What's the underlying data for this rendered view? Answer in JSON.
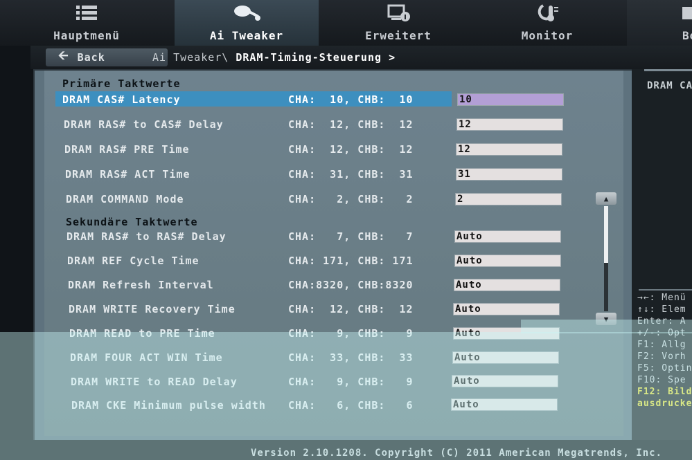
{
  "tabs": [
    {
      "id": "hauptmenu",
      "label": "Hauptmenü",
      "icon": "list-icon"
    },
    {
      "id": "ai-tweaker",
      "label": "Ai Tweaker",
      "icon": "tweaker-icon",
      "active": true
    },
    {
      "id": "erweitert",
      "label": "Erweitert",
      "icon": "advanced-icon"
    },
    {
      "id": "monitor",
      "label": "Monitor",
      "icon": "thermometer-icon"
    },
    {
      "id": "boot",
      "label": "Bo",
      "icon": "boot-icon"
    }
  ],
  "breadcrumb": {
    "back_label": "Back",
    "path": "Ai Tweaker\\",
    "current": "DRAM-Timing-Steuerung",
    "arrow": ">"
  },
  "sections": {
    "primary": "Primäre Taktwerte",
    "secondary": "Sekundäre Taktwerte"
  },
  "rows": [
    {
      "name": "DRAM CAS# Latency",
      "values": "CHA:  10, CHB:  10",
      "field": "10",
      "selected": true
    },
    {
      "name": "DRAM RAS# to CAS# Delay",
      "values": "CHA:  12, CHB:  12",
      "field": "12"
    },
    {
      "name": "DRAM RAS# PRE Time",
      "values": "CHA:  12, CHB:  12",
      "field": "12"
    },
    {
      "name": "DRAM RAS# ACT Time",
      "values": "CHA:  31, CHB:  31",
      "field": "31"
    },
    {
      "name": "DRAM COMMAND Mode",
      "values": "CHA:   2, CHB:   2",
      "field": "2"
    },
    {
      "name": "DRAM RAS# to RAS# Delay",
      "values": "CHA:   7, CHB:   7",
      "field": "Auto"
    },
    {
      "name": "DRAM REF Cycle Time",
      "values": "CHA: 171, CHB: 171",
      "field": "Auto"
    },
    {
      "name": "DRAM Refresh Interval",
      "values": "CHA:8320, CHB:8320",
      "field": "Auto"
    },
    {
      "name": "DRAM WRITE Recovery Time",
      "values": "CHA:  12, CHB:  12",
      "field": "Auto"
    },
    {
      "name": "DRAM READ to PRE Time",
      "values": "CHA:   9, CHB:   9",
      "field": "Auto"
    },
    {
      "name": "DRAM FOUR ACT WIN Time",
      "values": "CHA:  33, CHB:  33",
      "field": "Auto"
    },
    {
      "name": "DRAM WRITE to READ Delay",
      "values": "CHA:   9, CHB:   9",
      "field": "Auto"
    },
    {
      "name": "DRAM CKE Minimum pulse width",
      "values": "CHA:   6, CHB:   6",
      "field": "Auto"
    }
  ],
  "help": {
    "title": "DRAM CA",
    "keys": [
      "→←: Menü",
      "↑↓: Elem",
      "Enter: A",
      "+/-: Opt",
      "F1: Allg",
      "F2: Vorh",
      "F5: Optin",
      "F10: Spe"
    ],
    "keys_highlight": [
      "F12: Bild",
      "ausdrucke"
    ]
  },
  "version": "Version 2.10.1208. Copyright (C) 2011 American Megatrends, Inc.",
  "colors": {
    "panel": "#6e828e",
    "selection": "#3d8fbf",
    "active_field": "#b39fd6",
    "help_highlight": "#e6de36"
  }
}
